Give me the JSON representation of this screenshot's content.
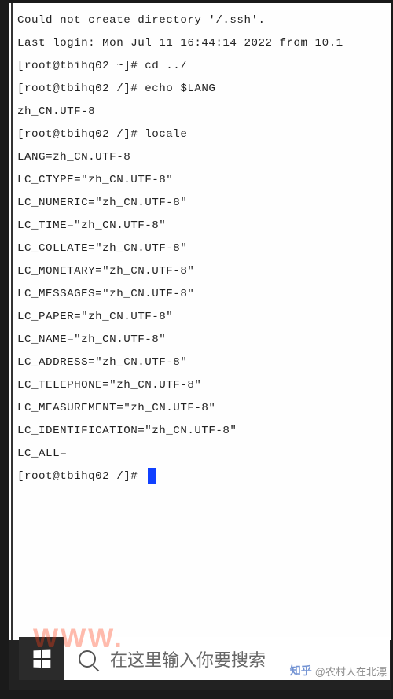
{
  "terminal": {
    "lines": [
      "Could not create directory '/.ssh'.",
      "Last login: Mon Jul 11 16:44:14 2022 from 10.1",
      "[root@tbihq02 ~]#  cd ../",
      "[root@tbihq02 /]# echo $LANG",
      "zh_CN.UTF-8",
      "[root@tbihq02 /]# locale",
      "LANG=zh_CN.UTF-8",
      "LC_CTYPE=\"zh_CN.UTF-8\"",
      "LC_NUMERIC=\"zh_CN.UTF-8\"",
      "LC_TIME=\"zh_CN.UTF-8\"",
      "LC_COLLATE=\"zh_CN.UTF-8\"",
      "LC_MONETARY=\"zh_CN.UTF-8\"",
      "LC_MESSAGES=\"zh_CN.UTF-8\"",
      "LC_PAPER=\"zh_CN.UTF-8\"",
      "LC_NAME=\"zh_CN.UTF-8\"",
      "LC_ADDRESS=\"zh_CN.UTF-8\"",
      "LC_TELEPHONE=\"zh_CN.UTF-8\"",
      "LC_MEASUREMENT=\"zh_CN.UTF-8\"",
      "LC_IDENTIFICATION=\"zh_CN.UTF-8\"",
      "LC_ALL="
    ],
    "prompt": "[root@tbihq02 /]# "
  },
  "taskbar": {
    "search_placeholder": "在这里输入你要搜索"
  },
  "watermarks": {
    "red": "WWW.",
    "zhihu_logo": "知乎",
    "zhihu_user": "@农村人在北漂"
  }
}
